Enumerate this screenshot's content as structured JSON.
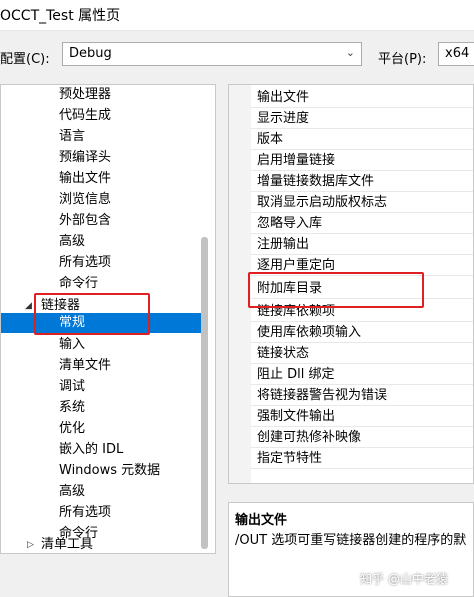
{
  "window": {
    "title": "OCCT_Test 属性页"
  },
  "config": {
    "label": "配置(C):",
    "value": "Debug",
    "platform_label": "平台(P):",
    "platform_value": "x64"
  },
  "tree": {
    "items": [
      "预处理器",
      "代码生成",
      "语言",
      "预编译头",
      "输出文件",
      "浏览信息",
      "外部包含",
      "高级",
      "所有选项",
      "命令行",
      "链接器",
      "常规",
      "输入",
      "清单文件",
      "调试",
      "系统",
      "优化",
      "嵌入的 IDL",
      "Windows 元数据",
      "高级",
      "所有选项",
      "命令行",
      "清单工具"
    ]
  },
  "grid": {
    "rows": [
      "输出文件",
      "显示进度",
      "版本",
      "启用增量链接",
      "增量链接数据库文件",
      "取消显示启动版权标志",
      "忽略导入库",
      "注册输出",
      "逐用户重定向",
      "附加库目录",
      "链接库依赖项",
      "使用库依赖项输入",
      "链接状态",
      "阻止 Dll 绑定",
      "将链接器警告视为错误",
      "强制文件输出",
      "创建可热修补映像",
      "指定节特性"
    ]
  },
  "description": {
    "title": "输出文件",
    "text": "/OUT 选项可重写链接器创建的程序的默"
  },
  "watermark": "知乎 @山中老猿",
  "colors": {
    "selection": "#0078d7",
    "highlight_box": "#e02020"
  }
}
